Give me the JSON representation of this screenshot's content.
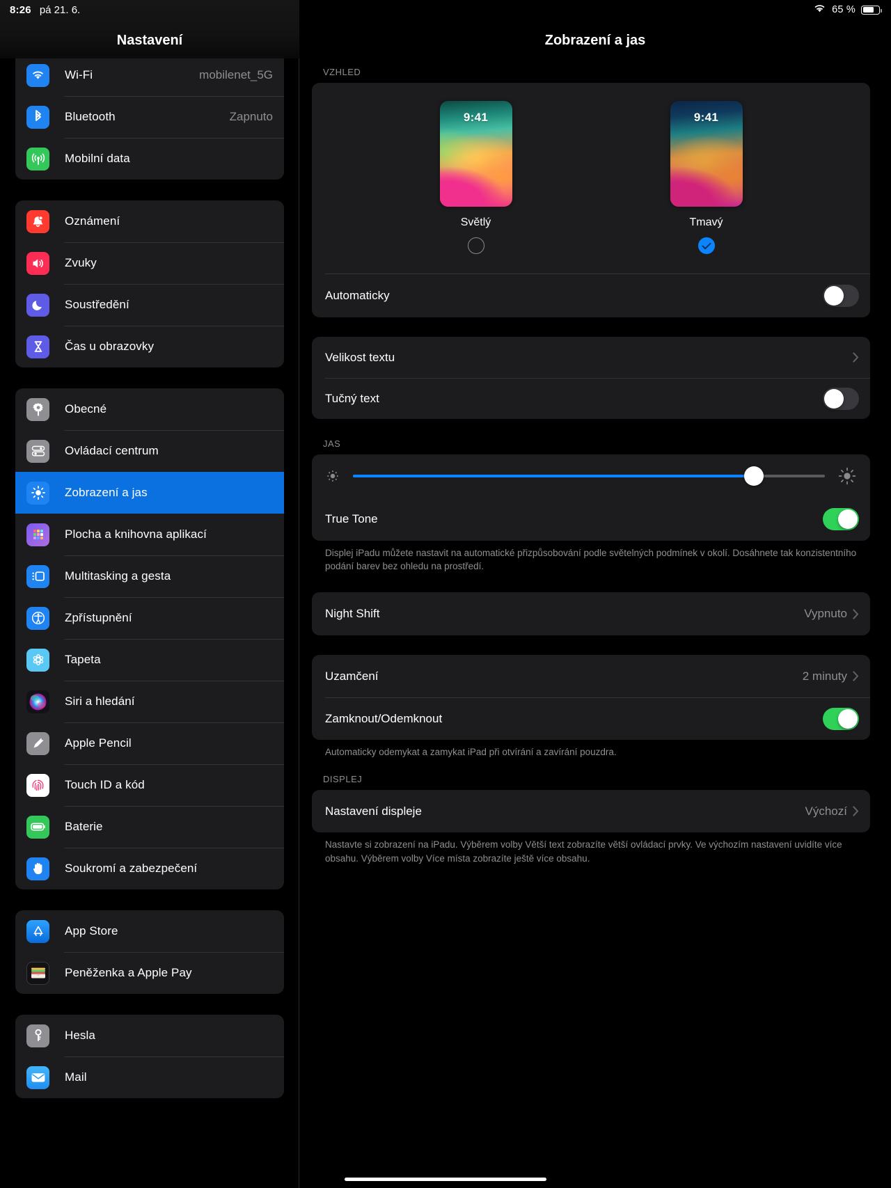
{
  "statusbar": {
    "time": "8:26",
    "date": "pá 21. 6.",
    "battery_percent": "65 %",
    "wifi_icon": "wifi-icon",
    "battery_icon": "battery-icon"
  },
  "sidebar": {
    "title": "Nastavení",
    "groups": [
      {
        "id": "connectivity",
        "items": [
          {
            "label": "Wi-Fi",
            "value": "mobilenet_5G",
            "icon": "wifi-icon",
            "selected": false
          },
          {
            "label": "Bluetooth",
            "value": "Zapnuto",
            "icon": "bluetooth-icon",
            "selected": false
          },
          {
            "label": "Mobilní data",
            "value": "",
            "icon": "cellular-icon",
            "selected": false
          }
        ]
      },
      {
        "id": "notifications",
        "items": [
          {
            "label": "Oznámení",
            "value": "",
            "icon": "bell-icon",
            "selected": false
          },
          {
            "label": "Zvuky",
            "value": "",
            "icon": "speaker-icon",
            "selected": false
          },
          {
            "label": "Soustředění",
            "value": "",
            "icon": "moon-icon",
            "selected": false
          },
          {
            "label": "Čas u obrazovky",
            "value": "",
            "icon": "hourglass-icon",
            "selected": false
          }
        ]
      },
      {
        "id": "system",
        "items": [
          {
            "label": "Obecné",
            "value": "",
            "icon": "gear-icon",
            "selected": false
          },
          {
            "label": "Ovládací centrum",
            "value": "",
            "icon": "sliders-icon",
            "selected": false
          },
          {
            "label": "Zobrazení a jas",
            "value": "",
            "icon": "brightness-icon",
            "selected": true
          },
          {
            "label": "Plocha a knihovna aplikací",
            "value": "",
            "icon": "app-grid-icon",
            "selected": false
          },
          {
            "label": "Multitasking a gesta",
            "value": "",
            "icon": "multitasking-icon",
            "selected": false
          },
          {
            "label": "Zpřístupnění",
            "value": "",
            "icon": "accessibility-icon",
            "selected": false
          },
          {
            "label": "Tapeta",
            "value": "",
            "icon": "wallpaper-icon",
            "selected": false
          },
          {
            "label": "Siri a hledání",
            "value": "",
            "icon": "siri-icon",
            "selected": false
          },
          {
            "label": "Apple Pencil",
            "value": "",
            "icon": "pencil-icon",
            "selected": false
          },
          {
            "label": "Touch ID a kód",
            "value": "",
            "icon": "fingerprint-icon",
            "selected": false
          },
          {
            "label": "Baterie",
            "value": "",
            "icon": "battery-icon",
            "selected": false
          },
          {
            "label": "Soukromí a zabezpečení",
            "value": "",
            "icon": "hand-icon",
            "selected": false
          }
        ]
      },
      {
        "id": "store",
        "items": [
          {
            "label": "App Store",
            "value": "",
            "icon": "app-store-icon",
            "selected": false
          },
          {
            "label": "Peněženka a Apple Pay",
            "value": "",
            "icon": "wallet-icon",
            "selected": false
          }
        ]
      },
      {
        "id": "accounts",
        "items": [
          {
            "label": "Hesla",
            "value": "",
            "icon": "key-icon",
            "selected": false
          },
          {
            "label": "Mail",
            "value": "",
            "icon": "mail-icon",
            "selected": false
          }
        ]
      }
    ]
  },
  "detail": {
    "title": "Zobrazení a jas",
    "appearance": {
      "section_header": "VZHLED",
      "options": [
        {
          "name": "Světlý",
          "preview_time": "9:41",
          "selected": false
        },
        {
          "name": "Tmavý",
          "preview_time": "9:41",
          "selected": true
        }
      ],
      "auto_label": "Automaticky",
      "auto_on": false
    },
    "text_group": [
      {
        "label": "Velikost textu",
        "type": "disclosure",
        "value": ""
      },
      {
        "label": "Tučný text",
        "type": "toggle",
        "on": false
      }
    ],
    "brightness": {
      "section_header": "JAS",
      "value_percent": 85,
      "low_icon": "sun-small-icon",
      "high_icon": "sun-large-icon",
      "true_tone_label": "True Tone",
      "true_tone_on": true,
      "footer": "Displej iPadu můžete nastavit na automatické přizpůsobování podle světelných podmínek v okolí. Dosáhnete tak konzistentního podání barev bez ohledu na prostředí."
    },
    "night_shift": {
      "label": "Night Shift",
      "value": "Vypnuto"
    },
    "lock_group": {
      "auto_lock": {
        "label": "Uzamčení",
        "value": "2 minuty"
      },
      "lock_unlock": {
        "label": "Zamknout/Odemknout",
        "on": true
      },
      "footer": "Automaticky odemykat a zamykat iPad při otvírání a zavírání pouzdra."
    },
    "display_group": {
      "section_header": "DISPLEJ",
      "row": {
        "label": "Nastavení displeje",
        "value": "Výchozí"
      },
      "footer": "Nastavte si zobrazení na iPadu. Výběrem volby Větší text zobrazíte větší ovládací prvky. Ve výchozím nastavení uvidíte více obsahu. Výběrem volby Více místa zobrazíte ještě více obsahu."
    }
  },
  "colors": {
    "accent_blue": "#0a84ff",
    "selected_row": "#0c71e0",
    "toggle_on_green": "#2fd158",
    "card_bg": "#1c1c1e",
    "secondary_text": "#8e8e93"
  }
}
